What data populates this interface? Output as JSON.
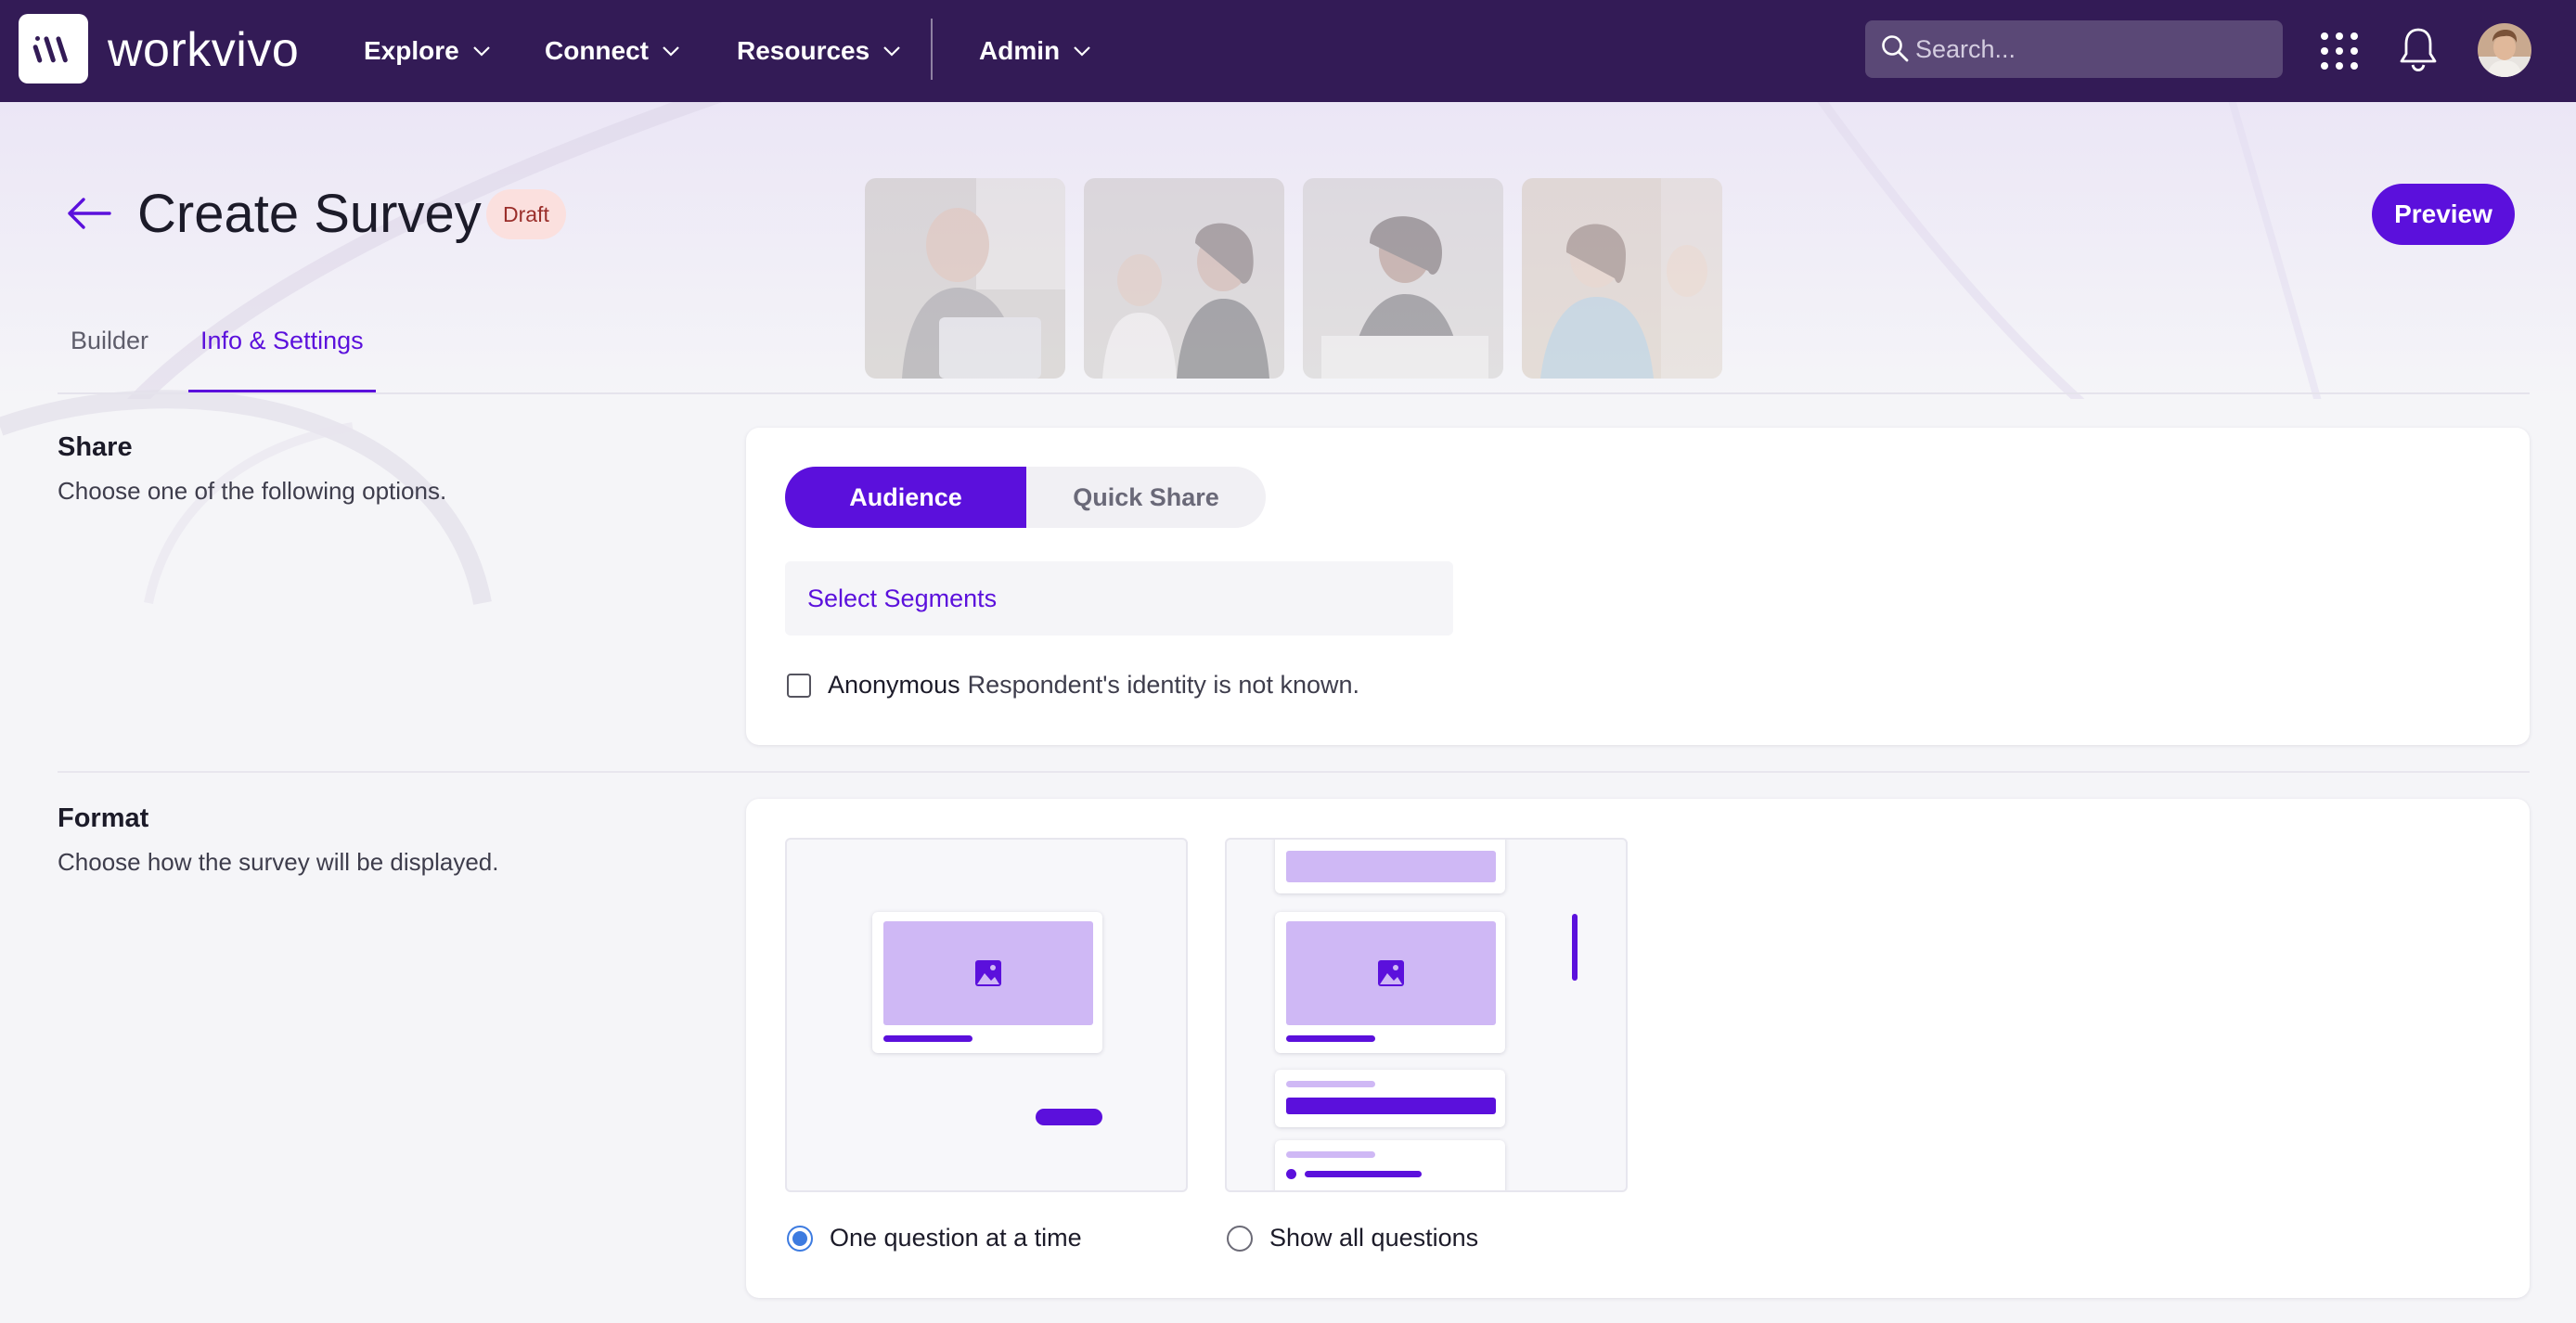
{
  "nav": {
    "brand": "workvivo",
    "items": [
      {
        "label": "Explore"
      },
      {
        "label": "Connect"
      },
      {
        "label": "Resources"
      },
      {
        "label": "Admin"
      }
    ],
    "search_placeholder": "Search..."
  },
  "header": {
    "title": "Create Survey",
    "status_badge": "Draft",
    "preview_label": "Preview"
  },
  "tabs": [
    {
      "label": "Builder",
      "active": false
    },
    {
      "label": "Info & Settings",
      "active": true
    }
  ],
  "share": {
    "title": "Share",
    "description": "Choose one of the following options.",
    "toggle": {
      "options": [
        "Audience",
        "Quick Share"
      ],
      "selected": "Audience"
    },
    "segments_label": "Select Segments",
    "anonymous": {
      "label": "Anonymous",
      "description": "Respondent's identity is not known.",
      "checked": false
    }
  },
  "format": {
    "title": "Format",
    "description": "Choose how the survey will be displayed.",
    "options": [
      {
        "label": "One question at a time",
        "selected": true
      },
      {
        "label": "Show all questions",
        "selected": false
      }
    ]
  },
  "colors": {
    "nav_bg": "#331b56",
    "accent": "#5b10dc",
    "accent_light": "#cfb8f5",
    "badge_bg": "#fbe0de",
    "radio_checked": "#3d7be0"
  },
  "icons": {
    "logo": "workvivo-logo-icon",
    "back": "arrow-left-icon",
    "search": "search-icon",
    "apps": "grid-icon",
    "notifications": "bell-icon",
    "image_placeholder": "image-icon"
  }
}
